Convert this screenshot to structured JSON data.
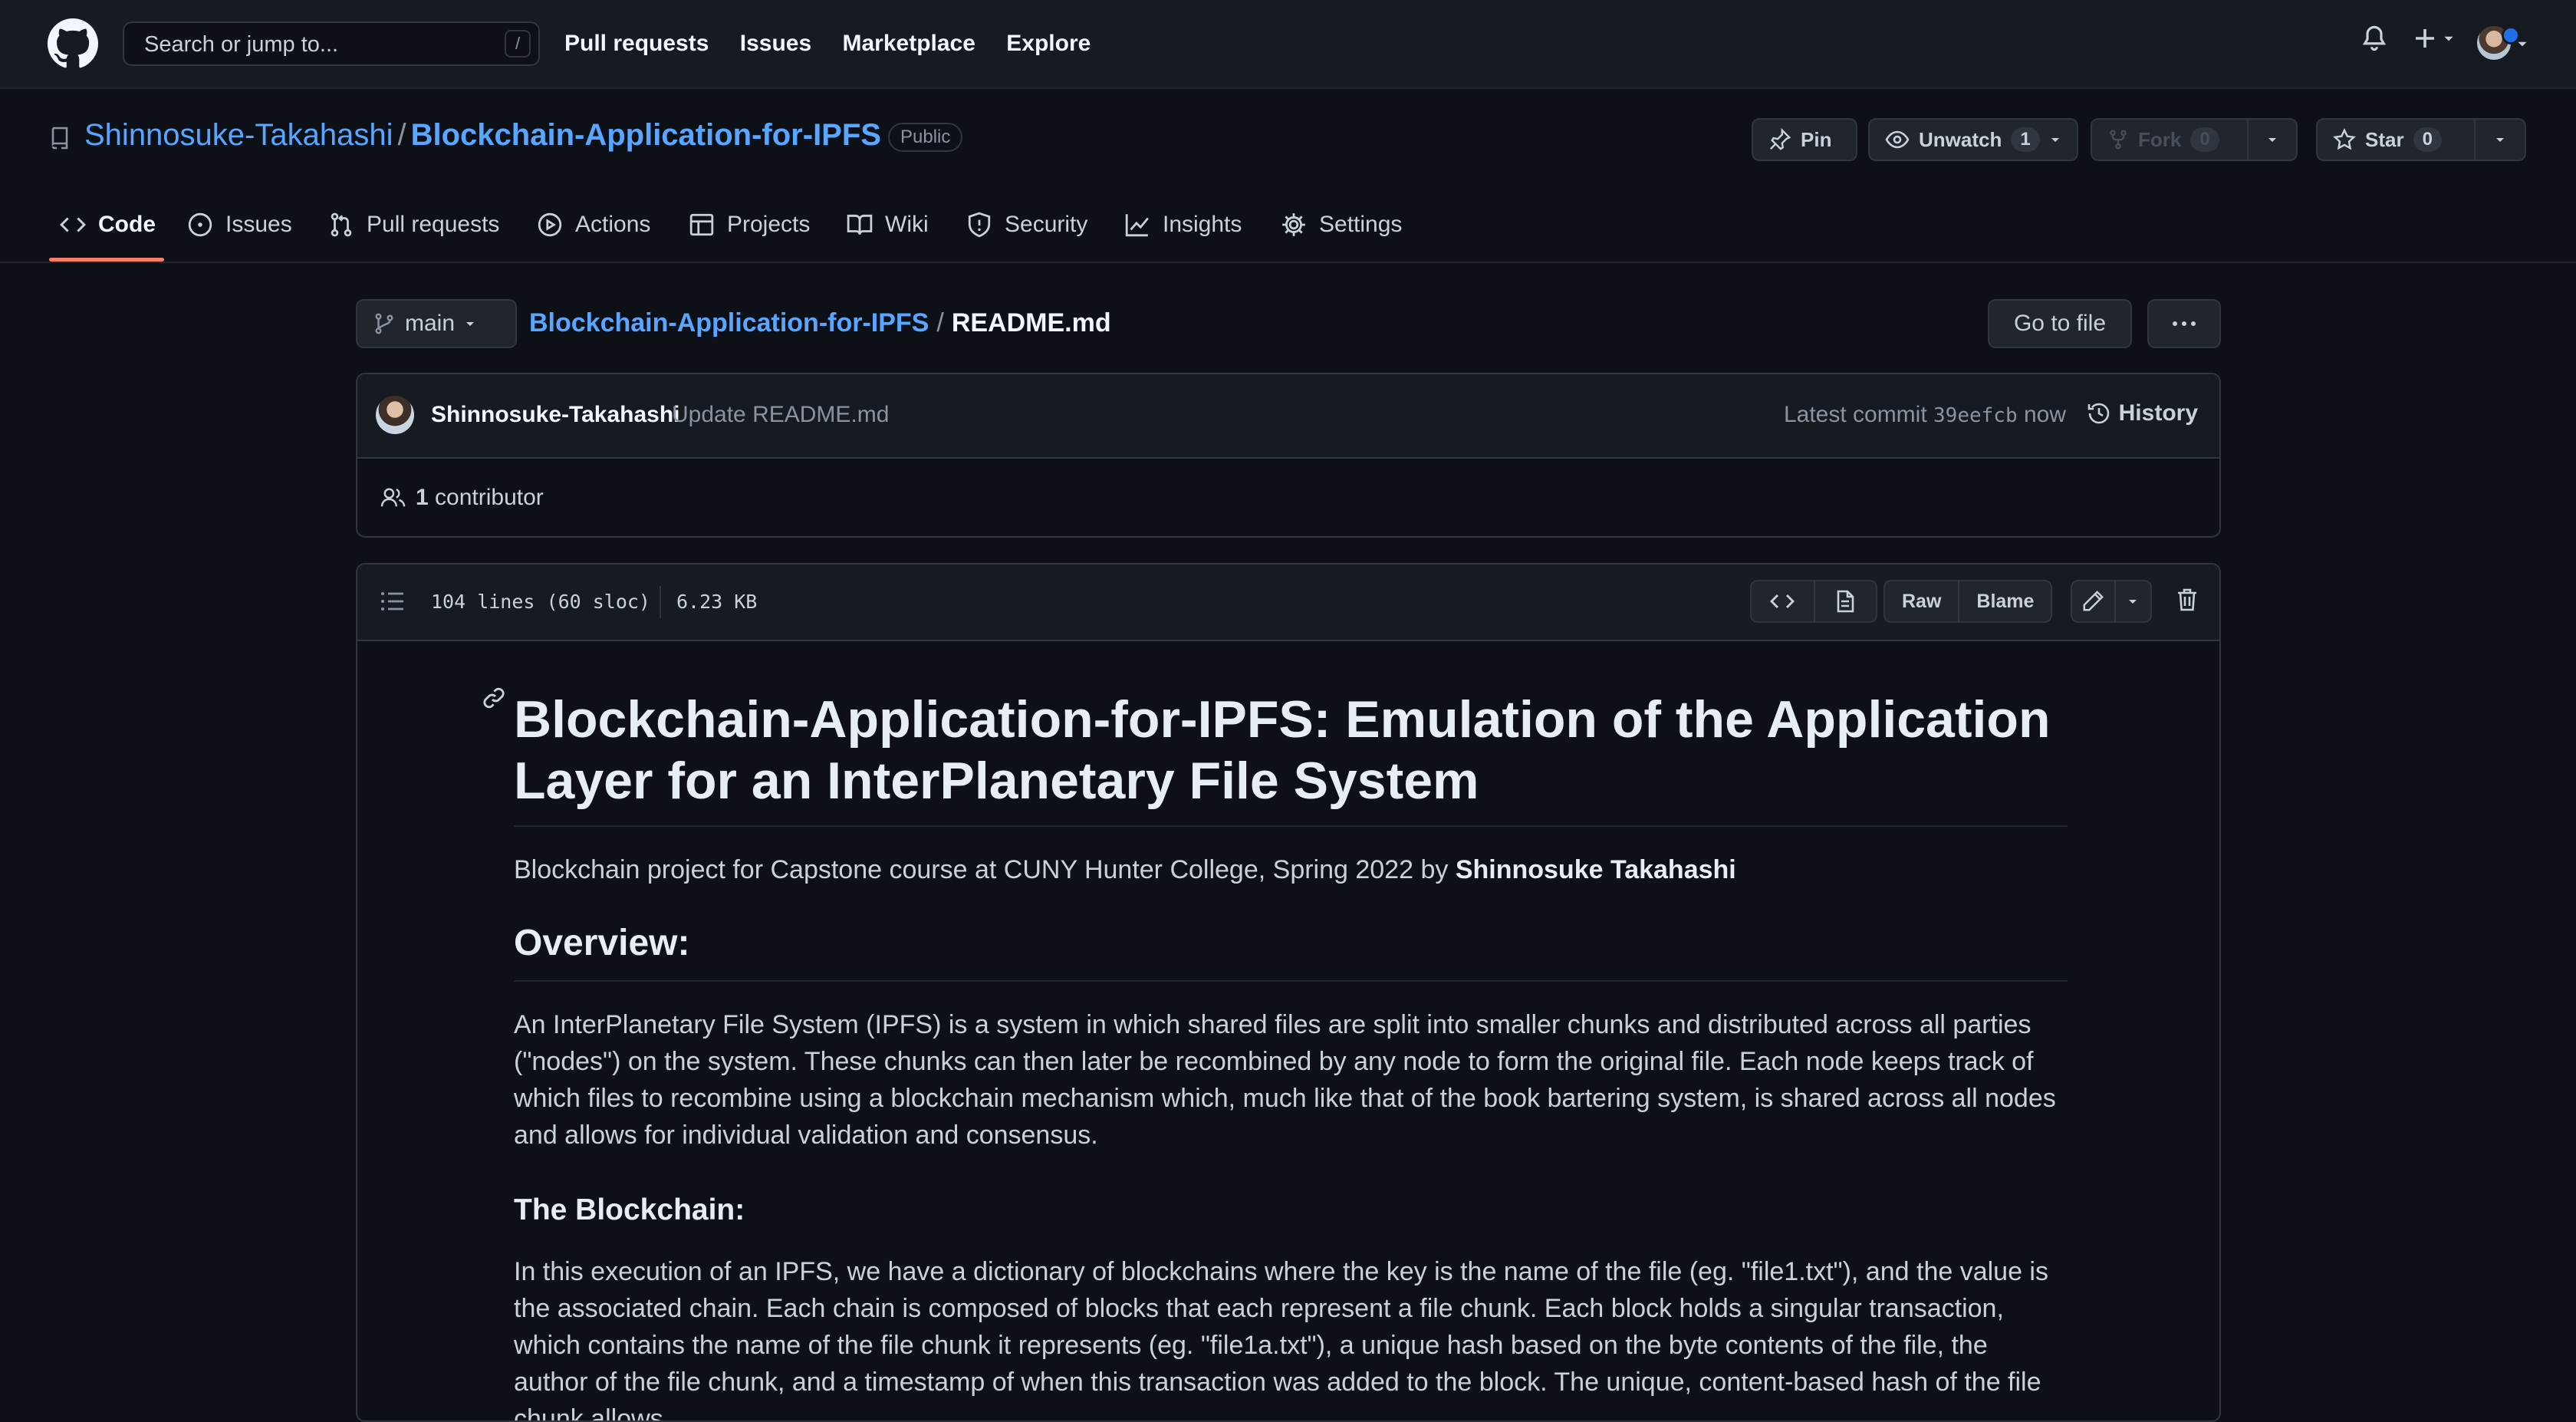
{
  "header": {
    "search_placeholder": "Search or jump to...",
    "search_shortcut": "/",
    "nav": [
      "Pull requests",
      "Issues",
      "Marketplace",
      "Explore"
    ]
  },
  "repo": {
    "owner": "Shinnosuke-Takahashi",
    "separator": "/",
    "name": "Blockchain-Application-for-IPFS",
    "visibility": "Public",
    "pin_label": "Pin",
    "unwatch_label": "Unwatch",
    "watch_count": "1",
    "fork_label": "Fork",
    "fork_count": "0",
    "star_label": "Star",
    "star_count": "0"
  },
  "tabs": [
    {
      "label": "Code",
      "icon": "code-icon",
      "selected": true
    },
    {
      "label": "Issues",
      "icon": "issue-icon"
    },
    {
      "label": "Pull requests",
      "icon": "pull-request-icon"
    },
    {
      "label": "Actions",
      "icon": "play-icon"
    },
    {
      "label": "Projects",
      "icon": "table-icon"
    },
    {
      "label": "Wiki",
      "icon": "book-icon"
    },
    {
      "label": "Security",
      "icon": "shield-icon"
    },
    {
      "label": "Insights",
      "icon": "graph-icon"
    },
    {
      "label": "Settings",
      "icon": "gear-icon"
    }
  ],
  "file_header": {
    "branch": "main",
    "repo_link": "Blockchain-Application-for-IPFS",
    "separator": "/",
    "file_name": "README.md",
    "goto_label": "Go to file",
    "more_label": "···"
  },
  "commit": {
    "author": "Shinnosuke-Takahashi",
    "message": "Update README.md",
    "latest_label": "Latest commit",
    "sha": "39eefcb",
    "time": "now",
    "history_label": "History",
    "contributors_count": "1",
    "contributors_label": "contributor"
  },
  "file_info": {
    "lines": "104 lines (60 sloc)",
    "size": "6.23 KB",
    "raw_label": "Raw",
    "blame_label": "Blame"
  },
  "readme": {
    "title": "Blockchain-Application-for-IPFS: Emulation of the Application Layer for an InterPlanetary File System",
    "intro": "Blockchain project for Capstone course at CUNY Hunter College, Spring 2022 by",
    "intro_author": "Shinnosuke Takahashi",
    "overview_heading": "Overview:",
    "overview_text": "An InterPlanetary File System (IPFS) is a system in which shared files are split into smaller chunks and distributed across all parties (\"nodes\") on the system. These chunks can then later be recombined by any node to form the original file. Each node keeps track of which files to recombine using a blockchain mechanism which, much like that of the book bartering system, is shared across all nodes and allows for individual validation and consensus.",
    "blockchain_heading": "The Blockchain:",
    "blockchain_text": "In this execution of an IPFS, we have a dictionary of blockchains where the key is the name of the file (eg. \"file1.txt\"), and the value is the associated chain. Each chain is composed of blocks that each represent a file chunk. Each block holds a singular transaction, which contains the name of the file chunk it represents (eg. \"file1a.txt\"), a unique hash based on the byte contents of the file, the author of the file chunk, and a timestamp of when this transaction was added to the block. The unique, content-based hash of the file chunk allows"
  }
}
